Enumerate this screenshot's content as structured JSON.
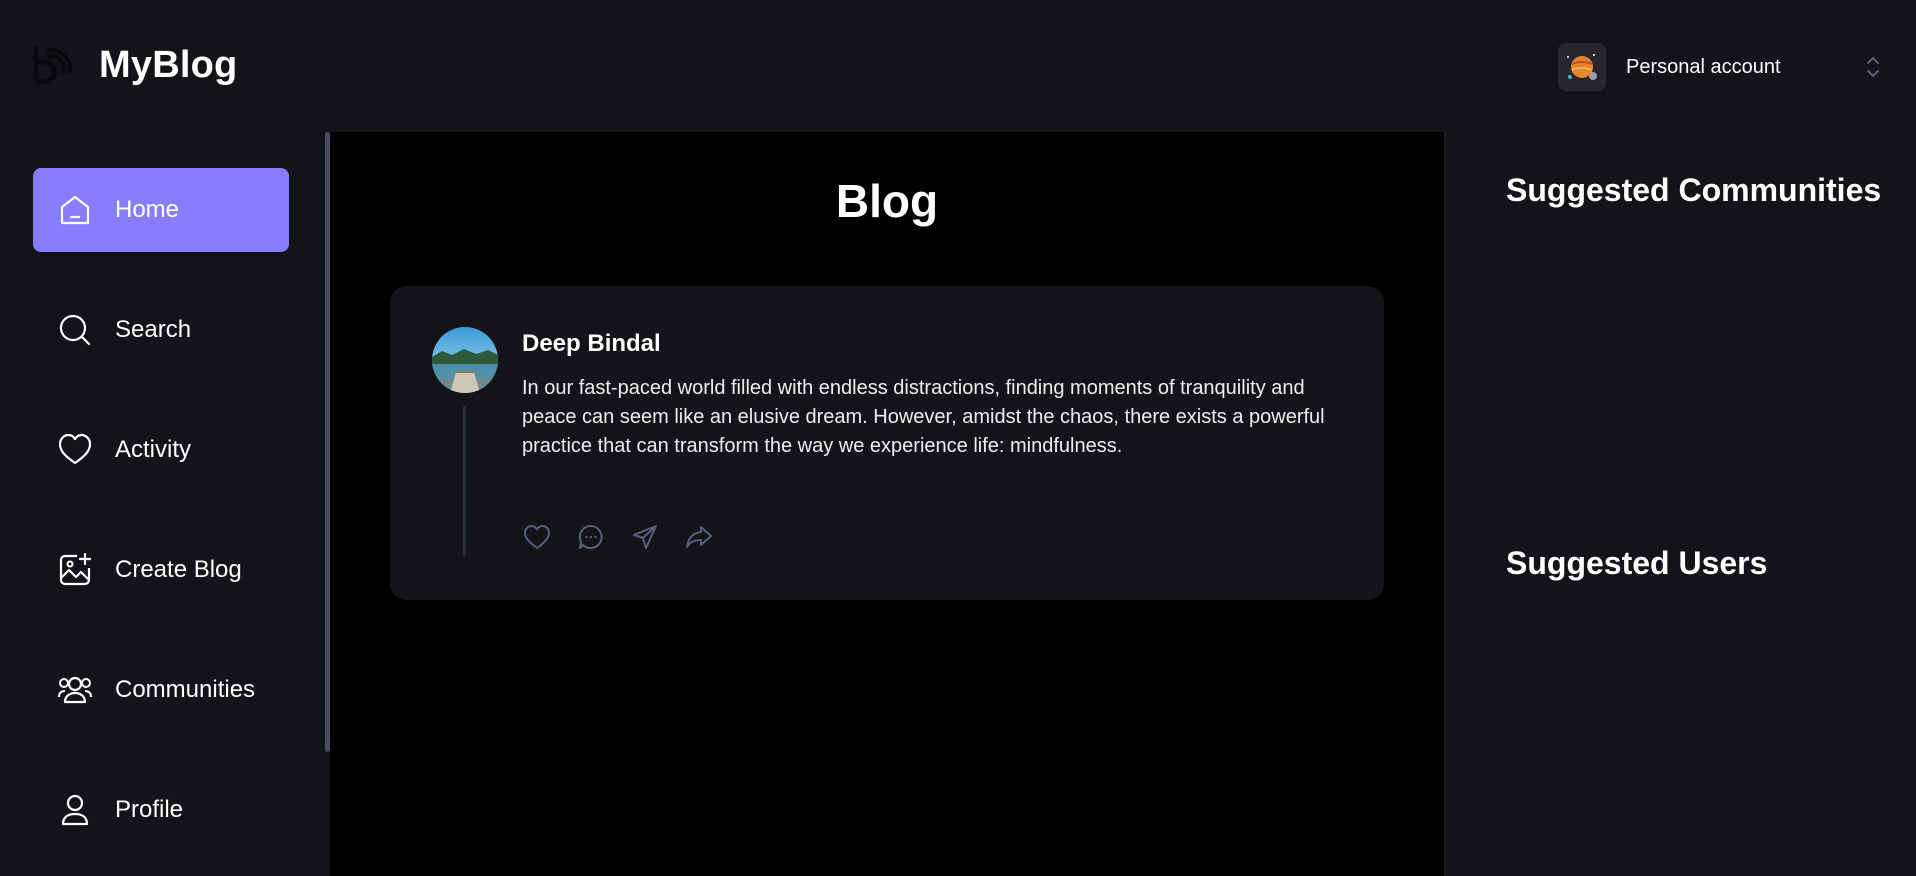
{
  "app": {
    "name": "MyBlog"
  },
  "account": {
    "label": "Personal account"
  },
  "sidebar": {
    "items": [
      {
        "label": "Home",
        "icon": "home-icon",
        "active": true
      },
      {
        "label": "Search",
        "icon": "search-icon",
        "active": false
      },
      {
        "label": "Activity",
        "icon": "heart-icon",
        "active": false
      },
      {
        "label": "Create Blog",
        "icon": "image-plus-icon",
        "active": false
      },
      {
        "label": "Communities",
        "icon": "users-icon",
        "active": false
      },
      {
        "label": "Profile",
        "icon": "user-icon",
        "active": false
      }
    ]
  },
  "main": {
    "title": "Blog",
    "posts": [
      {
        "author": "Deep Bindal",
        "text": "In our fast-paced world filled with endless distractions, finding moments of tranquility and peace can seem like an elusive dream. However, amidst the chaos, there exists a powerful practice that can transform the way we experience life: mindfulness."
      }
    ]
  },
  "rightbar": {
    "communities_title": "Suggested Communities",
    "users_title": "Suggested Users"
  },
  "colors": {
    "accent": "#877eff",
    "background": "#121417",
    "main_background": "#000000",
    "card": "#121417",
    "muted_icon": "#5c5c7b"
  }
}
